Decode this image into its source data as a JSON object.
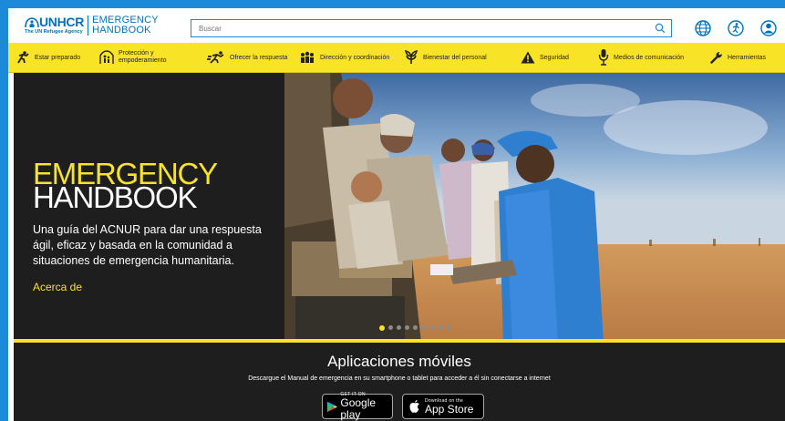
{
  "header": {
    "logo_name": "UNHCR",
    "logo_sub": "The UN Refugee Agency",
    "logo_line1": "EMERGENCY",
    "logo_line2": "HANDBOOK",
    "search_placeholder": "Buscar"
  },
  "nav": {
    "items": [
      {
        "label": "Estar preparado",
        "icon": "running-person-icon"
      },
      {
        "label": "Protección y",
        "label2": "empoderamiento",
        "icon": "family-icon"
      },
      {
        "label": "Ofrecer la respuesta",
        "icon": "runner-icon"
      },
      {
        "label": "Dirección y coordinación",
        "icon": "group-icon"
      },
      {
        "label": "Bienestar del personal",
        "icon": "leaf-icon"
      },
      {
        "label": "Seguridad",
        "icon": "warning-icon"
      },
      {
        "label": "Medios de comunicación",
        "icon": "microphone-icon"
      },
      {
        "label": "Herramientas",
        "icon": "wrench-icon"
      }
    ]
  },
  "hero": {
    "title_line1": "EMERGENCY",
    "title_line2": "HANDBOOK",
    "description": "Una guía del ACNUR para dar una respuesta ágil, eficaz y basada en la comunidad a situaciones de emergencia humanitaria.",
    "link": "Acerca de",
    "slides_total": 9,
    "active_slide": 1
  },
  "apps": {
    "title": "Aplicaciones móviles",
    "subtitle": "Descargue el Manual de emergencia en su smartphone o tablet para acceder a él sin conectarse a internet",
    "google_small": "GET IT ON",
    "google_big": "Google play",
    "apple_small": "Download on the",
    "apple_big": "App Store"
  },
  "colors": {
    "accent_yellow": "#f8e326",
    "brand_blue": "#0072bc",
    "dark_bg": "#1e1e1e"
  }
}
